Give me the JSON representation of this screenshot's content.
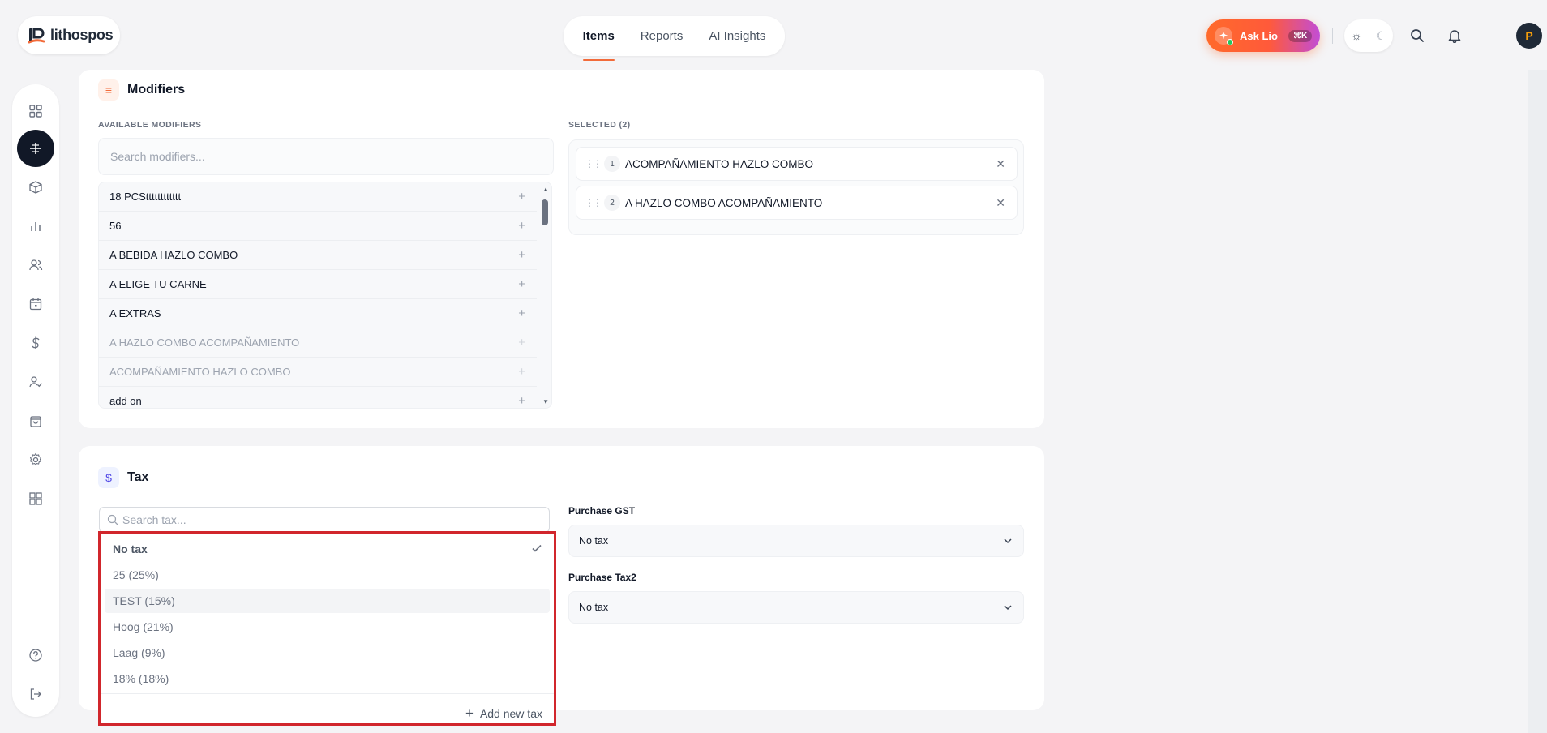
{
  "brand": {
    "name": "lithospos"
  },
  "topnav": {
    "tabs": [
      {
        "label": "Items"
      },
      {
        "label": "Reports"
      },
      {
        "label": "AI Insights"
      }
    ]
  },
  "ask": {
    "label": "Ask Lio",
    "shortcut": "⌘K"
  },
  "avatar": {
    "initial": "P"
  },
  "modifiers": {
    "title": "Modifiers",
    "available_label": "AVAILABLE MODIFIERS",
    "selected_label": "SELECTED (2)",
    "search_placeholder": "Search modifiers...",
    "available": [
      {
        "name": "18 PCStttttttttttt"
      },
      {
        "name": "56"
      },
      {
        "name": "A BEBIDA HAZLO COMBO"
      },
      {
        "name": "A ELIGE TU CARNE"
      },
      {
        "name": "A EXTRAS"
      },
      {
        "name": "A HAZLO COMBO ACOMPAÑAMIENTO"
      },
      {
        "name": "ACOMPAÑAMIENTO HAZLO COMBO"
      },
      {
        "name": "add on"
      }
    ],
    "selected": [
      {
        "index": "1",
        "name": "ACOMPAÑAMIENTO HAZLO COMBO"
      },
      {
        "index": "2",
        "name": "A HAZLO COMBO ACOMPAÑAMIENTO"
      }
    ]
  },
  "tax": {
    "title": "Tax",
    "search_placeholder": "Search tax...",
    "options": [
      {
        "label": "No tax"
      },
      {
        "label": "25 (25%)"
      },
      {
        "label": "TEST (15%)"
      },
      {
        "label": "Hoog (21%)"
      },
      {
        "label": "Laag (9%)"
      },
      {
        "label": "18% (18%)"
      }
    ],
    "add_label": "Add new tax",
    "purchase_gst": {
      "label": "Purchase GST",
      "value": "No tax"
    },
    "purchase_tax2": {
      "label": "Purchase Tax2",
      "value": "No tax"
    }
  },
  "colors": {
    "accent": "#f26b3a",
    "highlight_border": "#d1262c",
    "dark": "#111827"
  }
}
